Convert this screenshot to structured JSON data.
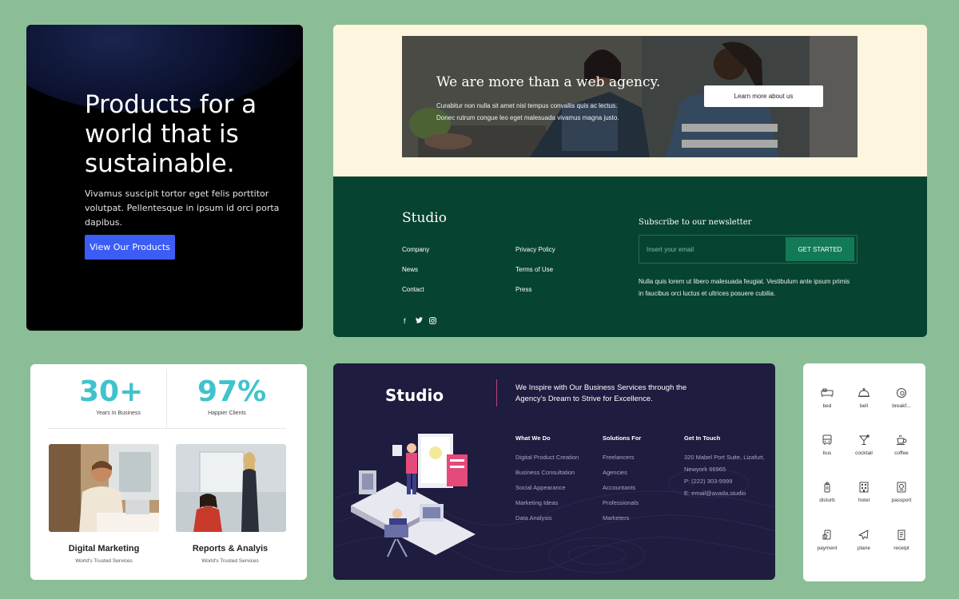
{
  "products": {
    "heading": "Products for a world that is sustainable.",
    "body": "Vivamus suscipit tortor eget felis porttitor volutpat. Pellentesque in ipsum id orci porta dapibus.",
    "button": "View Our Products",
    "button_color": "#3b5cf5"
  },
  "agency": {
    "hero_title": "We are more than a web agency.",
    "hero_sub": "Curabitur non nulla sit amet nisl tempus convallis quis ac lectus. Donec rutrum congue leo eget malesuada vivamus magna justo.",
    "hero_button": "Learn more about us",
    "footer": {
      "logo": "Studio",
      "links_col1": [
        "Company",
        "News",
        "Contact"
      ],
      "links_col2": [
        "Privacy Policy",
        "Terms of Use",
        "Press"
      ],
      "social": [
        "facebook-icon",
        "twitter-icon",
        "instagram-icon"
      ],
      "newsletter_title": "Subscribe to our newsletter",
      "input_placeholder": "Insert your email",
      "button": "GET STARTED",
      "newsletter_text": "Nulla quis lorem ut libero malesuada feugiat. Vestibulum ante ipsum primis in faucibus orci luctus et ultrices posuere cubilia.",
      "bg_color": "#064330"
    }
  },
  "stats": {
    "items": [
      {
        "value": "30+",
        "label": "Years In Business"
      },
      {
        "value": "97%",
        "label": "Happier Clients"
      }
    ],
    "services": [
      {
        "title": "Digital Marketing",
        "sub": "World's Trusted Services"
      },
      {
        "title": "Reports & Analyis",
        "sub": "World's Trusted Services"
      }
    ],
    "accent": "#3fc3cd"
  },
  "studio": {
    "logo": "Studio",
    "tagline": "We Inspire with Our Business Services through the Agency's Dream to Strive for Excellence.",
    "columns": [
      {
        "heading": "What We Do",
        "items": [
          "Digital Product Creation",
          "Business Consultation",
          "Social Appearance",
          "Marketing Ideas",
          "Data Analysis"
        ]
      },
      {
        "heading": "Solutions For",
        "items": [
          "Freelancers",
          "Agencies",
          "Accountants",
          "Professionals",
          "Marketers"
        ]
      },
      {
        "heading": "Get In Touch",
        "items": [
          "320 Mabel Port Suite, Lizafurt,",
          "Newyork 66965",
          "P: (222) 303-9999",
          "E: email@avada.studio"
        ]
      }
    ],
    "bg_color": "#1e1c3f"
  },
  "icons": {
    "items": [
      {
        "label": "bed",
        "icon": "bed-icon"
      },
      {
        "label": "bell",
        "icon": "bell-icon"
      },
      {
        "label": "breakf...",
        "icon": "breakfast-icon"
      },
      {
        "label": "bus",
        "icon": "bus-icon"
      },
      {
        "label": "cocktail",
        "icon": "cocktail-icon"
      },
      {
        "label": "coffee",
        "icon": "coffee-icon"
      },
      {
        "label": "disturb",
        "icon": "disturb-icon"
      },
      {
        "label": "hotel",
        "icon": "hotel-icon"
      },
      {
        "label": "passport",
        "icon": "passport-icon"
      },
      {
        "label": "payment",
        "icon": "payment-icon"
      },
      {
        "label": "plane",
        "icon": "plane-icon"
      },
      {
        "label": "receipt",
        "icon": "receipt-icon"
      }
    ]
  }
}
